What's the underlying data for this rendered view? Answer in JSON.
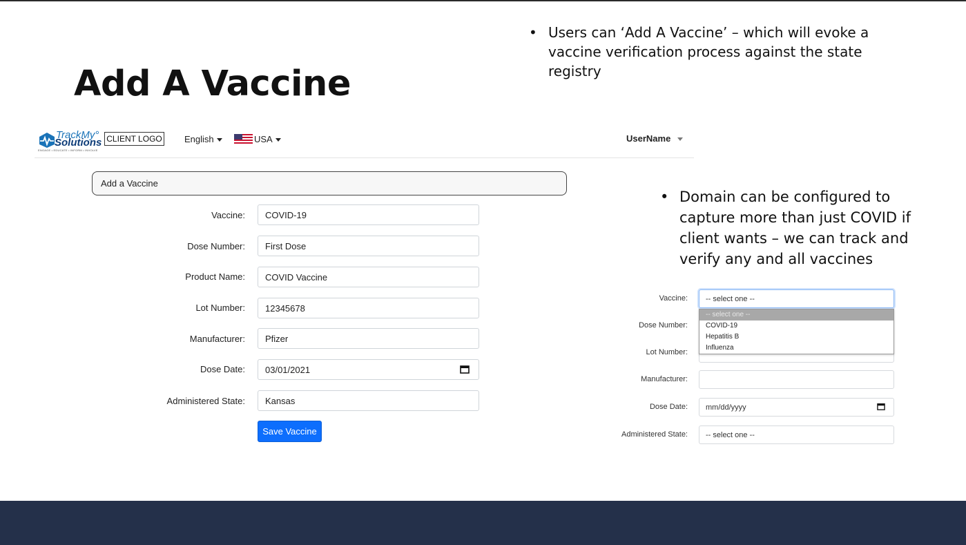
{
  "slide": {
    "title": "Add A Vaccine",
    "bullet1": "Users can ‘Add A Vaccine’ – which will evoke a vaccine verification process against the state registry",
    "bullet2": "Domain can be configured to capture more than just COVID if client wants – we can track and verify any and all vaccines",
    "bullet_glyph": "•"
  },
  "navbar": {
    "brand_line1": "TrackMy°",
    "brand_line2": "Solutions",
    "brand_tagline": "ENGAGE • EDUCATE • INFORM • INVOLVE",
    "client_logo": "CLIENT LOGO",
    "language": "English",
    "country": "USA",
    "username": "UserName"
  },
  "card": {
    "header": "Add a Vaccine"
  },
  "form": {
    "vaccine_label": "Vaccine:",
    "vaccine_value": "COVID-19",
    "dose_number_label": "Dose Number:",
    "dose_number_value": "First Dose",
    "product_name_label": "Product Name:",
    "product_name_value": "COVID Vaccine",
    "lot_number_label": "Lot Number:",
    "lot_number_value": "12345678",
    "manufacturer_label": "Manufacturer:",
    "manufacturer_value": "Pfizer",
    "dose_date_label": "Dose Date:",
    "dose_date_value": "03/01/2021",
    "state_label": "Administered State:",
    "state_value": "Kansas",
    "save_label": "Save Vaccine"
  },
  "mini_form": {
    "vaccine_label": "Vaccine:",
    "vaccine_placeholder": "-- select one --",
    "dose_number_label": "Dose Number:",
    "lot_number_label": "Lot Number:",
    "manufacturer_label": "Manufacturer:",
    "manufacturer_value": "",
    "dose_date_label": "Dose Date:",
    "dose_date_placeholder": "mm/dd/yyyy",
    "state_label": "Administered State:",
    "state_placeholder": "-- select one --",
    "options": [
      "-- select one --",
      "COVID-19",
      "Hepatitis B",
      "Influenza"
    ]
  },
  "icons": {
    "calendar": "calendar-icon",
    "caret": "chevron-down-icon",
    "flag": "us-flag-icon",
    "logo": "trackmy-logo-icon"
  },
  "colors": {
    "primary_button": "#0d6efd",
    "footer_band": "#24304a",
    "focus_ring": "#8bb8f5",
    "selected_option": "#a8a8a8"
  }
}
